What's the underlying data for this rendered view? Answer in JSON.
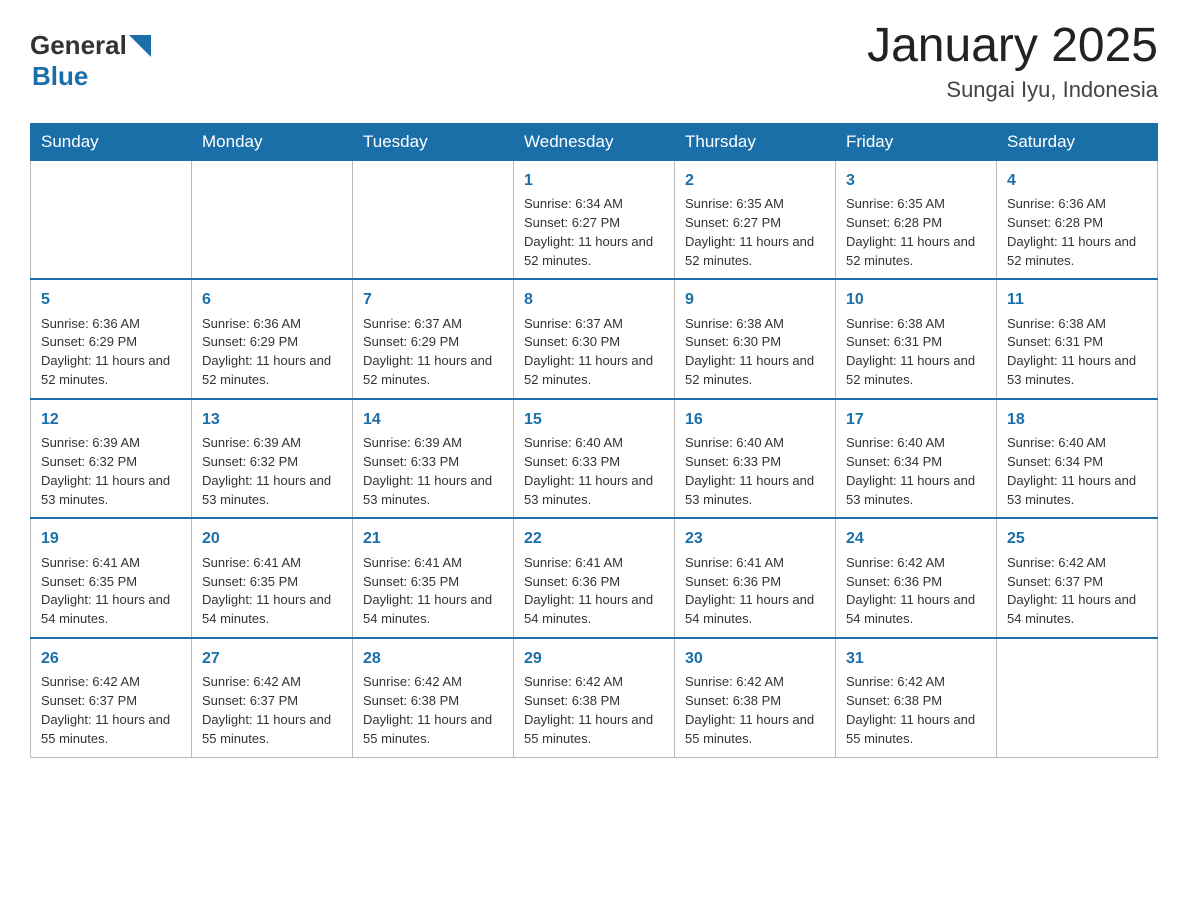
{
  "header": {
    "logo_general": "General",
    "logo_blue": "Blue",
    "month_title": "January 2025",
    "location": "Sungai Iyu, Indonesia"
  },
  "days_of_week": [
    "Sunday",
    "Monday",
    "Tuesday",
    "Wednesday",
    "Thursday",
    "Friday",
    "Saturday"
  ],
  "weeks": [
    [
      {
        "day": "",
        "info": ""
      },
      {
        "day": "",
        "info": ""
      },
      {
        "day": "",
        "info": ""
      },
      {
        "day": "1",
        "info": "Sunrise: 6:34 AM\nSunset: 6:27 PM\nDaylight: 11 hours and 52 minutes."
      },
      {
        "day": "2",
        "info": "Sunrise: 6:35 AM\nSunset: 6:27 PM\nDaylight: 11 hours and 52 minutes."
      },
      {
        "day": "3",
        "info": "Sunrise: 6:35 AM\nSunset: 6:28 PM\nDaylight: 11 hours and 52 minutes."
      },
      {
        "day": "4",
        "info": "Sunrise: 6:36 AM\nSunset: 6:28 PM\nDaylight: 11 hours and 52 minutes."
      }
    ],
    [
      {
        "day": "5",
        "info": "Sunrise: 6:36 AM\nSunset: 6:29 PM\nDaylight: 11 hours and 52 minutes."
      },
      {
        "day": "6",
        "info": "Sunrise: 6:36 AM\nSunset: 6:29 PM\nDaylight: 11 hours and 52 minutes."
      },
      {
        "day": "7",
        "info": "Sunrise: 6:37 AM\nSunset: 6:29 PM\nDaylight: 11 hours and 52 minutes."
      },
      {
        "day": "8",
        "info": "Sunrise: 6:37 AM\nSunset: 6:30 PM\nDaylight: 11 hours and 52 minutes."
      },
      {
        "day": "9",
        "info": "Sunrise: 6:38 AM\nSunset: 6:30 PM\nDaylight: 11 hours and 52 minutes."
      },
      {
        "day": "10",
        "info": "Sunrise: 6:38 AM\nSunset: 6:31 PM\nDaylight: 11 hours and 52 minutes."
      },
      {
        "day": "11",
        "info": "Sunrise: 6:38 AM\nSunset: 6:31 PM\nDaylight: 11 hours and 53 minutes."
      }
    ],
    [
      {
        "day": "12",
        "info": "Sunrise: 6:39 AM\nSunset: 6:32 PM\nDaylight: 11 hours and 53 minutes."
      },
      {
        "day": "13",
        "info": "Sunrise: 6:39 AM\nSunset: 6:32 PM\nDaylight: 11 hours and 53 minutes."
      },
      {
        "day": "14",
        "info": "Sunrise: 6:39 AM\nSunset: 6:33 PM\nDaylight: 11 hours and 53 minutes."
      },
      {
        "day": "15",
        "info": "Sunrise: 6:40 AM\nSunset: 6:33 PM\nDaylight: 11 hours and 53 minutes."
      },
      {
        "day": "16",
        "info": "Sunrise: 6:40 AM\nSunset: 6:33 PM\nDaylight: 11 hours and 53 minutes."
      },
      {
        "day": "17",
        "info": "Sunrise: 6:40 AM\nSunset: 6:34 PM\nDaylight: 11 hours and 53 minutes."
      },
      {
        "day": "18",
        "info": "Sunrise: 6:40 AM\nSunset: 6:34 PM\nDaylight: 11 hours and 53 minutes."
      }
    ],
    [
      {
        "day": "19",
        "info": "Sunrise: 6:41 AM\nSunset: 6:35 PM\nDaylight: 11 hours and 54 minutes."
      },
      {
        "day": "20",
        "info": "Sunrise: 6:41 AM\nSunset: 6:35 PM\nDaylight: 11 hours and 54 minutes."
      },
      {
        "day": "21",
        "info": "Sunrise: 6:41 AM\nSunset: 6:35 PM\nDaylight: 11 hours and 54 minutes."
      },
      {
        "day": "22",
        "info": "Sunrise: 6:41 AM\nSunset: 6:36 PM\nDaylight: 11 hours and 54 minutes."
      },
      {
        "day": "23",
        "info": "Sunrise: 6:41 AM\nSunset: 6:36 PM\nDaylight: 11 hours and 54 minutes."
      },
      {
        "day": "24",
        "info": "Sunrise: 6:42 AM\nSunset: 6:36 PM\nDaylight: 11 hours and 54 minutes."
      },
      {
        "day": "25",
        "info": "Sunrise: 6:42 AM\nSunset: 6:37 PM\nDaylight: 11 hours and 54 minutes."
      }
    ],
    [
      {
        "day": "26",
        "info": "Sunrise: 6:42 AM\nSunset: 6:37 PM\nDaylight: 11 hours and 55 minutes."
      },
      {
        "day": "27",
        "info": "Sunrise: 6:42 AM\nSunset: 6:37 PM\nDaylight: 11 hours and 55 minutes."
      },
      {
        "day": "28",
        "info": "Sunrise: 6:42 AM\nSunset: 6:38 PM\nDaylight: 11 hours and 55 minutes."
      },
      {
        "day": "29",
        "info": "Sunrise: 6:42 AM\nSunset: 6:38 PM\nDaylight: 11 hours and 55 minutes."
      },
      {
        "day": "30",
        "info": "Sunrise: 6:42 AM\nSunset: 6:38 PM\nDaylight: 11 hours and 55 minutes."
      },
      {
        "day": "31",
        "info": "Sunrise: 6:42 AM\nSunset: 6:38 PM\nDaylight: 11 hours and 55 minutes."
      },
      {
        "day": "",
        "info": ""
      }
    ]
  ]
}
